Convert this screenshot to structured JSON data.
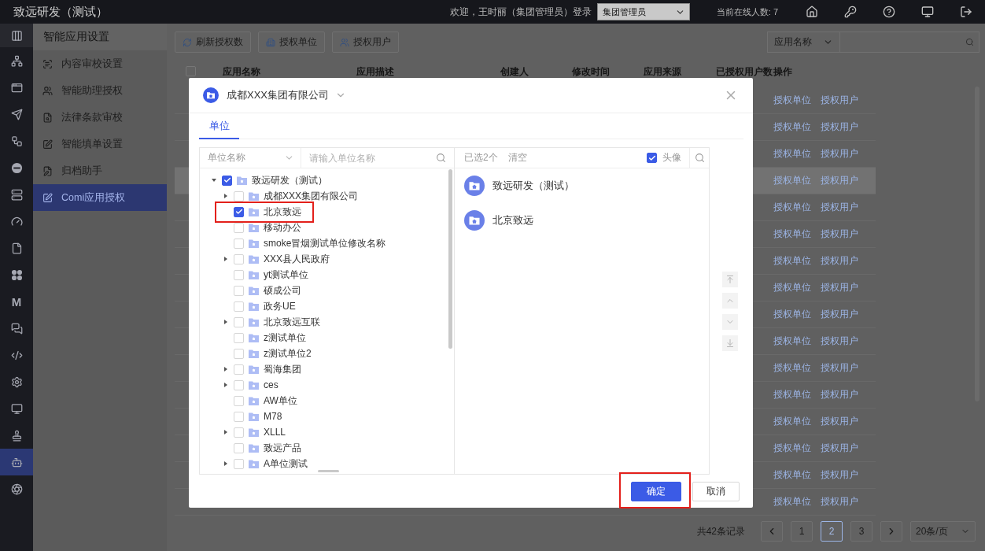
{
  "top_bar": {
    "title": "致远研发（测试）",
    "welcome": "欢迎，王时丽（集团管理员）登录",
    "role_select": "集团管理员",
    "online": "当前在线人数: 7"
  },
  "rail": [
    {
      "kind": "columns",
      "selected": false
    },
    {
      "kind": "org",
      "selected": false
    },
    {
      "kind": "window",
      "selected": false
    },
    {
      "kind": "send",
      "selected": false
    },
    {
      "kind": "flow",
      "selected": false
    },
    {
      "kind": "disc",
      "selected": false
    },
    {
      "kind": "server",
      "selected": false
    },
    {
      "kind": "gauge",
      "selected": false
    },
    {
      "kind": "file",
      "selected": false
    },
    {
      "kind": "petals",
      "selected": false
    },
    {
      "kind": "letter",
      "glyph": "M",
      "selected": false
    },
    {
      "kind": "chat",
      "selected": false
    },
    {
      "kind": "code",
      "selected": false
    },
    {
      "kind": "gear",
      "selected": false
    },
    {
      "kind": "monitor",
      "selected": false
    },
    {
      "kind": "stamp",
      "selected": false
    },
    {
      "kind": "robot",
      "selected": true
    },
    {
      "kind": "aperture",
      "selected": false
    }
  ],
  "nav": {
    "title": "智能应用设置",
    "items": [
      {
        "kind": "scan",
        "label": "内容审校设置",
        "selected": false
      },
      {
        "kind": "people",
        "label": "智能助理授权",
        "selected": false
      },
      {
        "kind": "doc",
        "label": "法律条款审校",
        "selected": false
      },
      {
        "kind": "form",
        "label": "智能填单设置",
        "selected": false
      },
      {
        "kind": "archive",
        "label": "归档助手",
        "selected": false
      },
      {
        "kind": "edit",
        "label": "Comi应用授权",
        "selected": true
      }
    ]
  },
  "toolbar": {
    "buttons": [
      {
        "kind": "refresh",
        "label": "刷新授权数"
      },
      {
        "kind": "unit",
        "label": "授权单位"
      },
      {
        "kind": "user",
        "label": "授权用户"
      }
    ],
    "filter_select": "应用名称"
  },
  "table": {
    "header_checkbox": {
      "checked": false
    },
    "columns": [
      "应用名称",
      "应用描述",
      "创建人",
      "修改时间",
      "应用来源",
      "已授权用户数",
      "操作"
    ],
    "rows": [
      {
        "actions": [
          "授权单位",
          "授权用户"
        ],
        "selected": false
      },
      {
        "actions": [
          "授权单位",
          "授权用户"
        ],
        "selected": false
      },
      {
        "actions": [
          "授权单位",
          "授权用户"
        ],
        "selected": false
      },
      {
        "actions": [
          "授权单位",
          "授权用户"
        ],
        "selected": true
      },
      {
        "actions": [
          "授权单位",
          "授权用户"
        ],
        "selected": false
      },
      {
        "actions": [
          "授权单位",
          "授权用户"
        ],
        "selected": false
      },
      {
        "actions": [
          "授权单位",
          "授权用户"
        ],
        "selected": false
      },
      {
        "actions": [
          "授权单位",
          "授权用户"
        ],
        "selected": false
      },
      {
        "actions": [
          "授权单位",
          "授权用户"
        ],
        "selected": false
      },
      {
        "actions": [
          "授权单位",
          "授权用户"
        ],
        "selected": false
      },
      {
        "actions": [
          "授权单位",
          "授权用户"
        ],
        "selected": false
      },
      {
        "actions": [
          "授权单位",
          "授权用户"
        ],
        "selected": false
      },
      {
        "actions": [
          "授权单位",
          "授权用户"
        ],
        "selected": false
      },
      {
        "actions": [
          "授权单位",
          "授权用户"
        ],
        "selected": false
      },
      {
        "actions": [
          "授权单位",
          "授权用户"
        ],
        "selected": false
      },
      {
        "actions": [
          "授权单位",
          "授权用户"
        ],
        "selected": false
      }
    ]
  },
  "pagination": {
    "total": "共42条记录",
    "pages": [
      {
        "label": "1",
        "selected": false
      },
      {
        "label": "2",
        "selected": true
      },
      {
        "label": "3",
        "selected": false
      }
    ],
    "page_size": "20条/页"
  },
  "dialog": {
    "org": "成都XXX集团有限公司",
    "tabs": [
      {
        "label": "单位",
        "selected": true
      }
    ],
    "filter_select": "单位名称",
    "search": {
      "placeholder": "请输入单位名称"
    },
    "tree": [
      {
        "label": "致远研发（测试）",
        "checked": true,
        "highlighted": false,
        "expanded": true,
        "children": [
          {
            "label": "成都XXX集团有限公司",
            "checked": false,
            "highlighted": false,
            "expanded": false
          },
          {
            "label": "北京致远",
            "checked": true,
            "highlighted": true
          },
          {
            "label": "移动办公",
            "checked": false,
            "highlighted": false
          },
          {
            "label": "smoke冒烟测试单位修改名称",
            "checked": false,
            "highlighted": false
          },
          {
            "label": "XXX县人民政府",
            "checked": false,
            "highlighted": false,
            "expanded": false
          },
          {
            "label": "yt测试单位",
            "checked": false,
            "highlighted": false
          },
          {
            "label": "硕成公司",
            "checked": false,
            "highlighted": false
          },
          {
            "label": "政务UE",
            "checked": false,
            "highlighted": false
          },
          {
            "label": "北京致远互联",
            "checked": false,
            "highlighted": false,
            "expanded": false
          },
          {
            "label": "z测试单位",
            "checked": false,
            "highlighted": false
          },
          {
            "label": "z测试单位2",
            "checked": false,
            "highlighted": false
          },
          {
            "label": "蜀海集团",
            "checked": false,
            "highlighted": false,
            "expanded": false
          },
          {
            "label": "ces",
            "checked": false,
            "highlighted": false,
            "expanded": false
          },
          {
            "label": "AW单位",
            "checked": false,
            "highlighted": false
          },
          {
            "label": "M78",
            "checked": false,
            "highlighted": false
          },
          {
            "label": "XLLL",
            "checked": false,
            "highlighted": false,
            "expanded": false
          },
          {
            "label": "致远产品",
            "checked": false,
            "highlighted": false
          },
          {
            "label": "A单位测试",
            "checked": false,
            "highlighted": false,
            "expanded": false
          }
        ]
      }
    ],
    "selected_panel": {
      "count": "已选2个",
      "clear": "清空",
      "avatar_toggle": {
        "label": "头像",
        "checked": true
      },
      "items": [
        {
          "label": "致远研发（测试）"
        },
        {
          "label": "北京致远"
        }
      ]
    },
    "buttons": [
      {
        "kind": "confirm",
        "label": "确定",
        "highlighted": true
      },
      {
        "kind": "cancel",
        "label": "取消",
        "highlighted": false
      }
    ]
  }
}
